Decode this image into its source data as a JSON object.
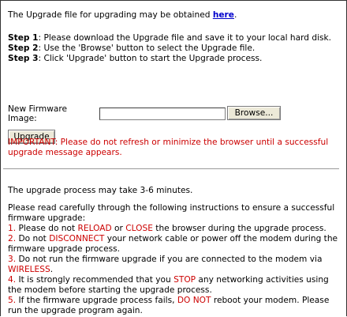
{
  "intro": {
    "text_before": "The Upgrade file for upgrading may be obtained ",
    "link_text": "here",
    "text_after": "."
  },
  "steps": [
    {
      "label": "Step 1",
      "text": ": Please download the Upgrade file and save it to your local hard disk."
    },
    {
      "label": "Step 2",
      "text": ": Use the 'Browse' button to select the Upgrade file."
    },
    {
      "label": "Step 3",
      "text": ": Click 'Upgrade' button to start the Upgrade process."
    }
  ],
  "firmware": {
    "label": "New Firmware Image:",
    "value": "",
    "browse_label": "Browse...",
    "upgrade_label": "Upgrade"
  },
  "warning": "IMPORTANT: Please do not refresh or minimize the browser until a successful upgrade message appears.",
  "time_note": "The upgrade process may take 3-6 minutes.",
  "instructions": {
    "intro": "Please read carefully through the following instructions to ensure a successful firmware upgrade:",
    "items": [
      {
        "num": "1.",
        "p1": " Please do not ",
        "k1": "RELOAD",
        "p2": " or ",
        "k2": "CLOSE",
        "p3": " the browser during the upgrade process."
      },
      {
        "num": "2.",
        "p1": " Do not ",
        "k1": "DISCONNECT",
        "p2": " your network cable or power off the modem during the firmware upgrade process.",
        "k2": "",
        "p3": ""
      },
      {
        "num": "3.",
        "p1": " Do not run the firmware upgrade if you are connected to the modem via ",
        "k1": "WIRELESS",
        "p2": ".",
        "k2": "",
        "p3": ""
      },
      {
        "num": "4.",
        "p1": " It is strongly recommended that you ",
        "k1": "STOP",
        "p2": " any networking activities using the modem before starting the upgrade process.",
        "k2": "",
        "p3": ""
      },
      {
        "num": "5.",
        "p1": " If the firmware upgrade process fails, ",
        "k1": "DO NOT",
        "p2": " reboot your modem. Please run the upgrade program again.",
        "k2": "",
        "p3": ""
      }
    ]
  },
  "colors": {
    "link": "#0000cc",
    "warning": "#cc0000",
    "border": "#333333"
  }
}
